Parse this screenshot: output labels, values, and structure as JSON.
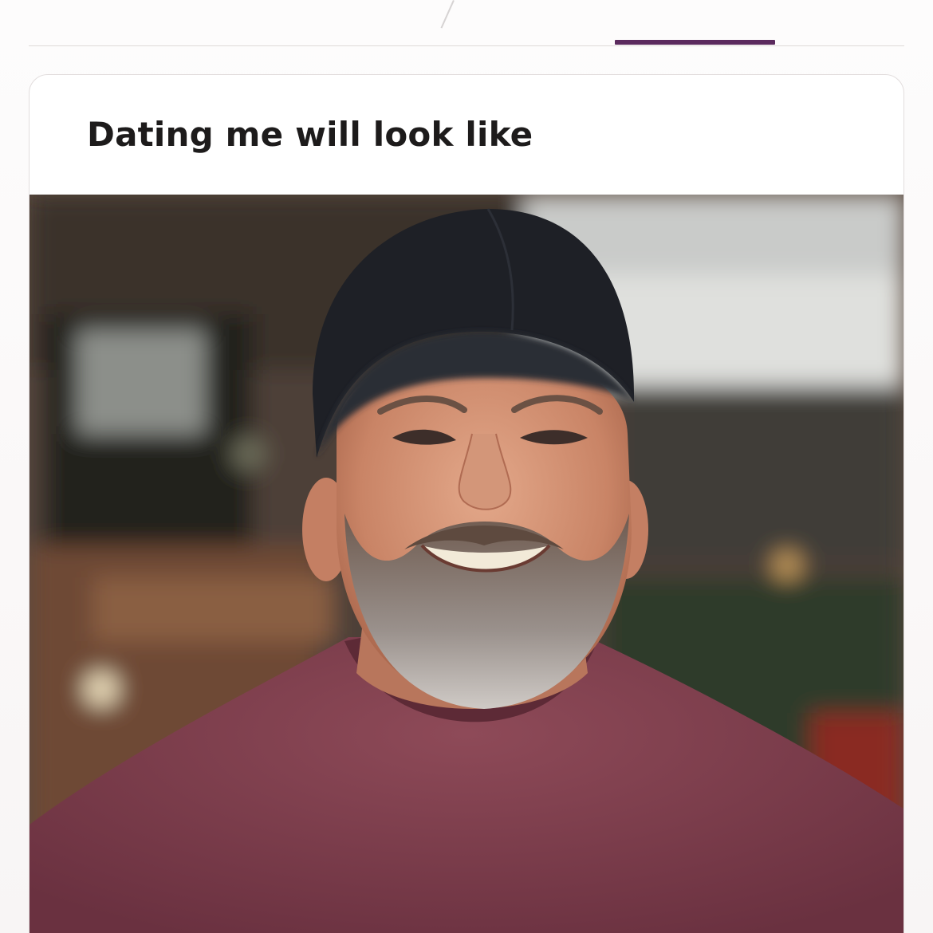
{
  "prompt_card": {
    "title": "Dating me will look like",
    "photo": {
      "subject": "smiling man with beard wearing black baseball cap and maroon t-shirt, outdoors",
      "icon": "profile-photo"
    }
  },
  "colors": {
    "tab_indicator": "#5b2a5e",
    "card_background": "#ffffff",
    "page_background": "#f8f5f5",
    "title_text": "#1d1b1b"
  }
}
